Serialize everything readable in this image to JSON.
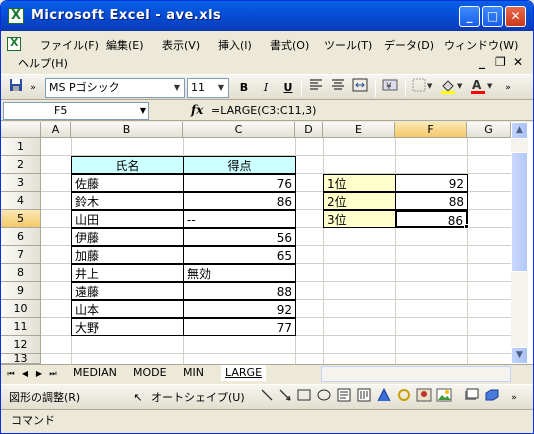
{
  "window": {
    "title": "Microsoft Excel - ave.xls"
  },
  "menu": {
    "items": [
      "ファイル(F)",
      "編集(E)",
      "表示(V)",
      "挿入(I)",
      "書式(O)",
      "ツール(T)",
      "データ(D)",
      "ウィンドウ(W)"
    ],
    "help": "ヘルプ(H)"
  },
  "toolbar": {
    "font": "MS Pゴシック",
    "size": "11",
    "bold": "B",
    "italic": "I",
    "underline": "U"
  },
  "formula_bar": {
    "name_box": "F5",
    "fx": "fx",
    "formula": "=LARGE(C3:C11,3)"
  },
  "columns": [
    "A",
    "B",
    "C",
    "D",
    "E",
    "F",
    "G"
  ],
  "rows": [
    "1",
    "2",
    "3",
    "4",
    "5",
    "6",
    "7",
    "8",
    "9",
    "10",
    "11",
    "12",
    "13"
  ],
  "table": {
    "header": [
      "氏名",
      "得点"
    ],
    "rows": [
      [
        "佐藤",
        "76"
      ],
      [
        "鈴木",
        "86"
      ],
      [
        "山田",
        "--"
      ],
      [
        "伊藤",
        "56"
      ],
      [
        "加藤",
        "65"
      ],
      [
        "井上",
        "無効"
      ],
      [
        "遠藤",
        "88"
      ],
      [
        "山本",
        "92"
      ],
      [
        "大野",
        "77"
      ]
    ]
  },
  "ranks": [
    [
      "1位",
      "92"
    ],
    [
      "2位",
      "88"
    ],
    [
      "3位",
      "86"
    ]
  ],
  "sheet_tabs": [
    "MEDIAN",
    "MODE",
    "MIN",
    "LARGE"
  ],
  "drawing_toolbar": {
    "adjust": "図形の調整(R)",
    "autoshape": "オートシェイプ(U)"
  },
  "status": "コマンド"
}
